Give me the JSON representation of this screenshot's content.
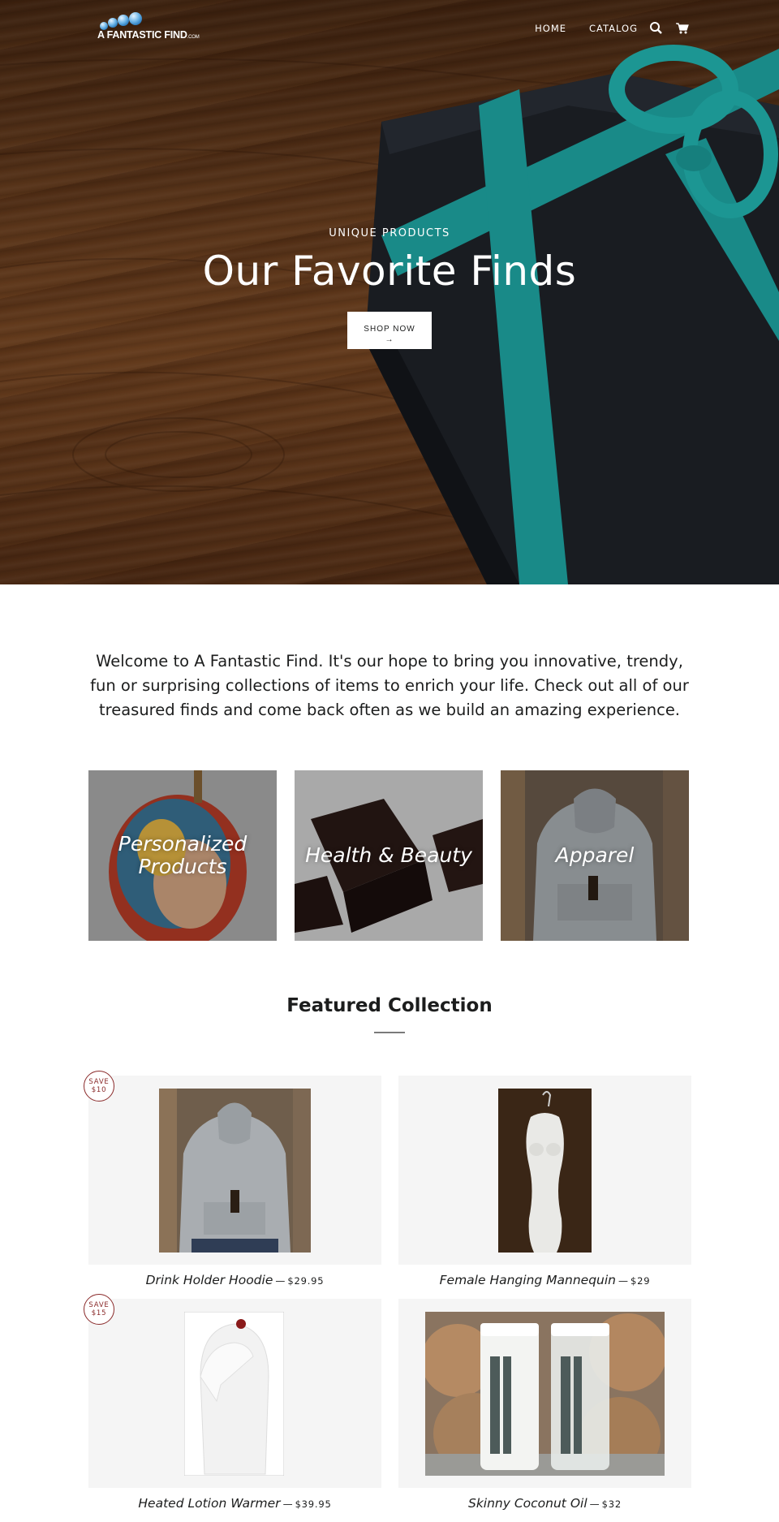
{
  "header": {
    "logo_text": "A FANTASTIC FIND",
    "logo_suffix": ".COM",
    "nav": [
      {
        "label": "HOME"
      },
      {
        "label": "CATALOG"
      }
    ],
    "icons": [
      "search-icon",
      "cart-icon"
    ]
  },
  "hero": {
    "eyebrow": "UNIQUE PRODUCTS",
    "title": "Our Favorite Finds",
    "button_label": "SHOP NOW",
    "button_arrow": "→"
  },
  "welcome": {
    "text": "Welcome to A Fantastic Find. It's our hope to bring you innovative, trendy, fun or surprising collections of items to enrich your life. Check out all of our treasured finds and come back often as we build an amazing experience."
  },
  "collections": [
    {
      "title": "Personalized Products"
    },
    {
      "title": "Health & Beauty"
    },
    {
      "title": "Apparel"
    }
  ],
  "featured": {
    "title": "Featured Collection",
    "products": [
      {
        "name": "Drink Holder Hoodie",
        "price": "$29.95",
        "badge_top": "SAVE",
        "badge_amount": "$10"
      },
      {
        "name": "Female Hanging Mannequin",
        "price": "$29"
      },
      {
        "name": "Heated Lotion Warmer",
        "price": "$39.95",
        "badge_top": "SAVE",
        "badge_amount": "$15"
      },
      {
        "name": "Skinny Coconut Oil",
        "price": "$32"
      }
    ]
  },
  "colors": {
    "accent_teal": "#2ab3b0",
    "badge_red": "#8a2a2a",
    "text": "#1c1d1d"
  }
}
